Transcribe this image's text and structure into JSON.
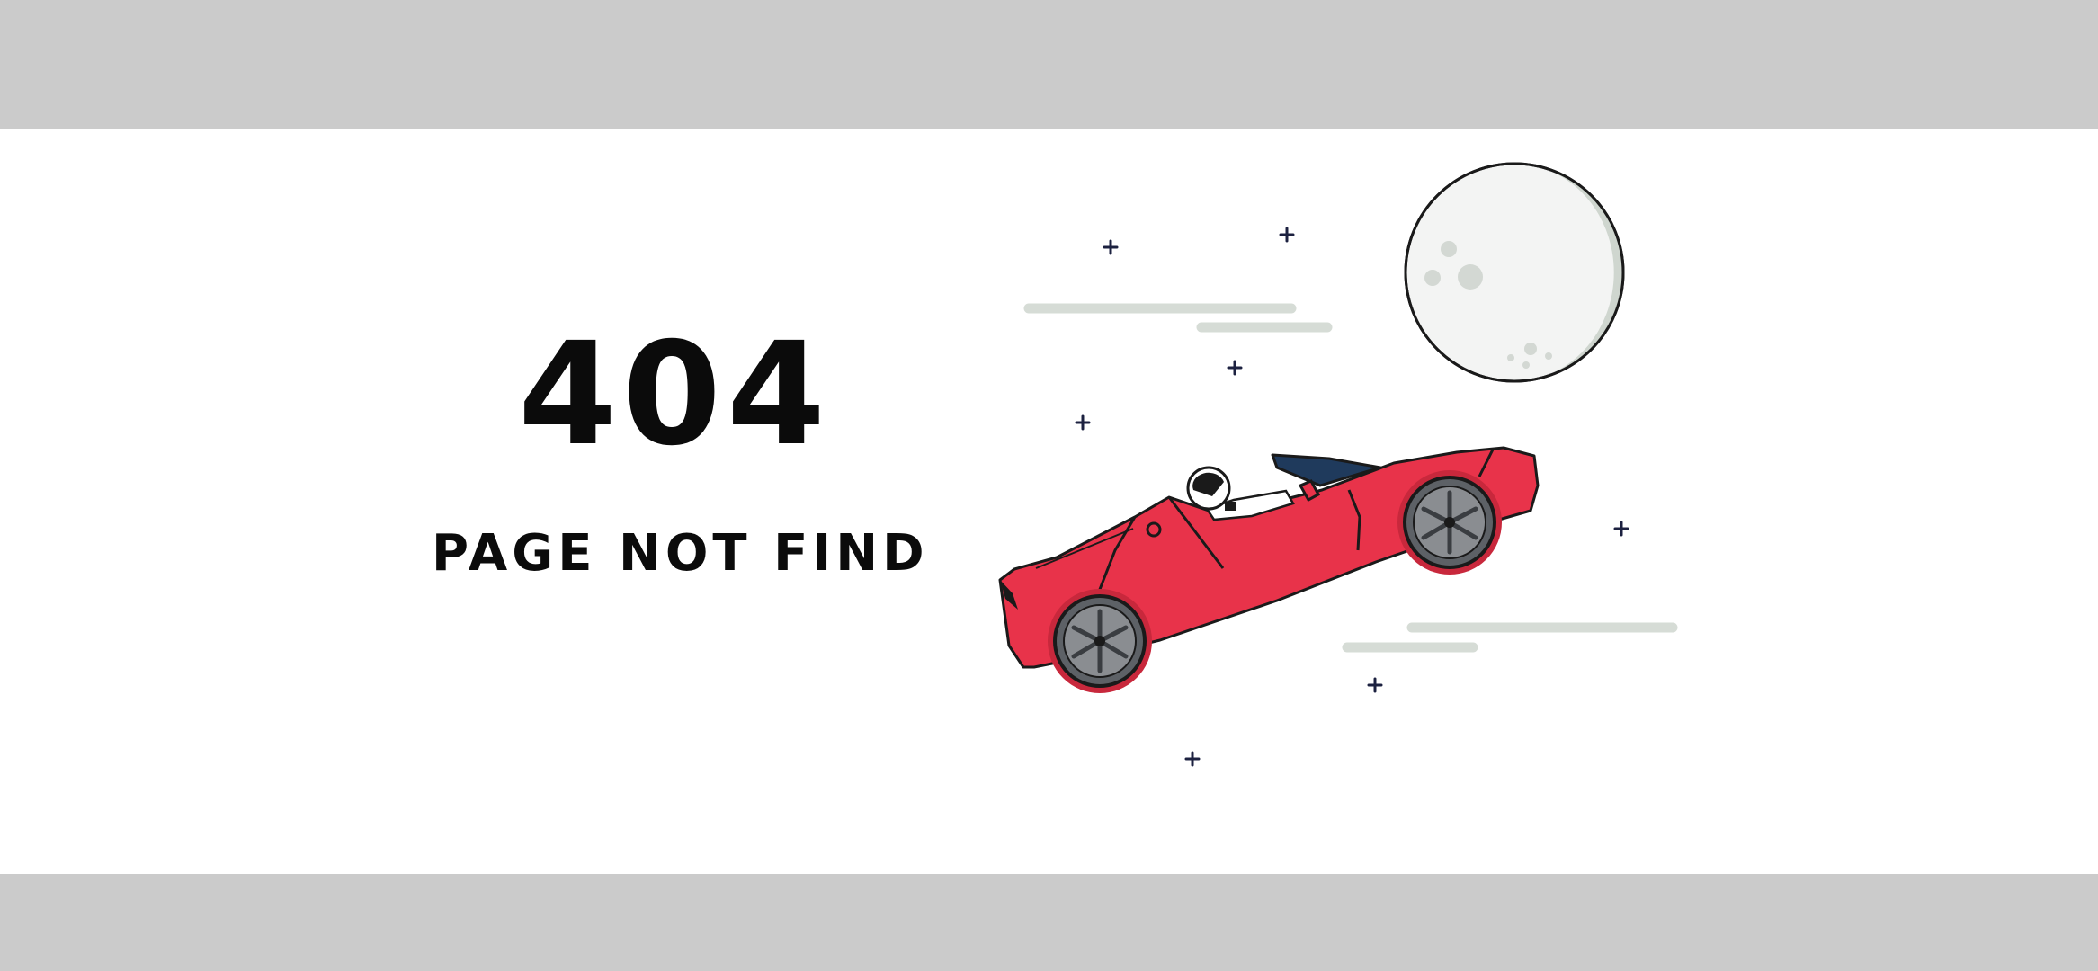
{
  "error": {
    "code": "404",
    "message": "PAGE NOT FIND"
  },
  "illustration": {
    "description_icon": "car-in-space-illustration",
    "colors": {
      "car_body": "#e8334a",
      "car_outline": "#1a1a1a",
      "car_interior": "#1f3a5c",
      "wheel": "#8a8d91",
      "moon": "#f3f4f3",
      "moon_shade": "#cfd6cf",
      "speed_lines": "#d6dcd6",
      "stars": "#1c2140"
    }
  },
  "colors": {
    "background_band": "#cbcbcb",
    "panel": "#ffffff",
    "text": "#0b0b0b"
  }
}
